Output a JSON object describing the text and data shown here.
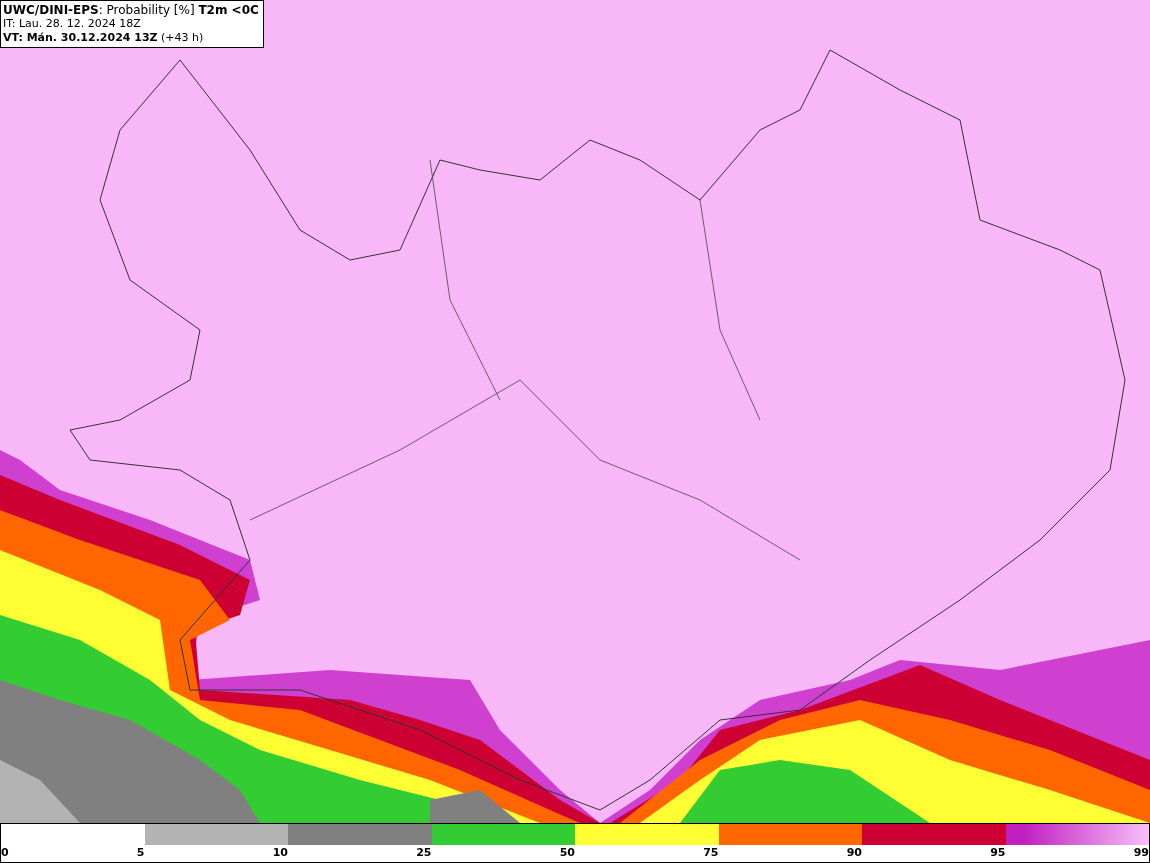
{
  "header": {
    "lines": [
      "**UWC/DINI-EPS**: Probability [%] **T2m <0C**",
      "IT: Lau. 28. 12. 2024 18Z",
      "**VT: Mán. 30.12.2024 13Z** (+43 h)"
    ]
  },
  "legend": {
    "segments": [
      {
        "kind": "solid",
        "color": "#b3b3b3"
      },
      {
        "kind": "solid",
        "color": "#808080"
      },
      {
        "kind": "solid",
        "color": "#33cc33"
      },
      {
        "kind": "solid",
        "color": "#ffff33"
      },
      {
        "kind": "solid",
        "color": "#ff6600"
      },
      {
        "kind": "solid",
        "color": "#cc0033"
      },
      {
        "kind": "gradient",
        "color": "#c020c0"
      }
    ],
    "ticks": [
      "0",
      "5",
      "10",
      "25",
      "50",
      "75",
      "90",
      "95",
      "99"
    ]
  }
}
